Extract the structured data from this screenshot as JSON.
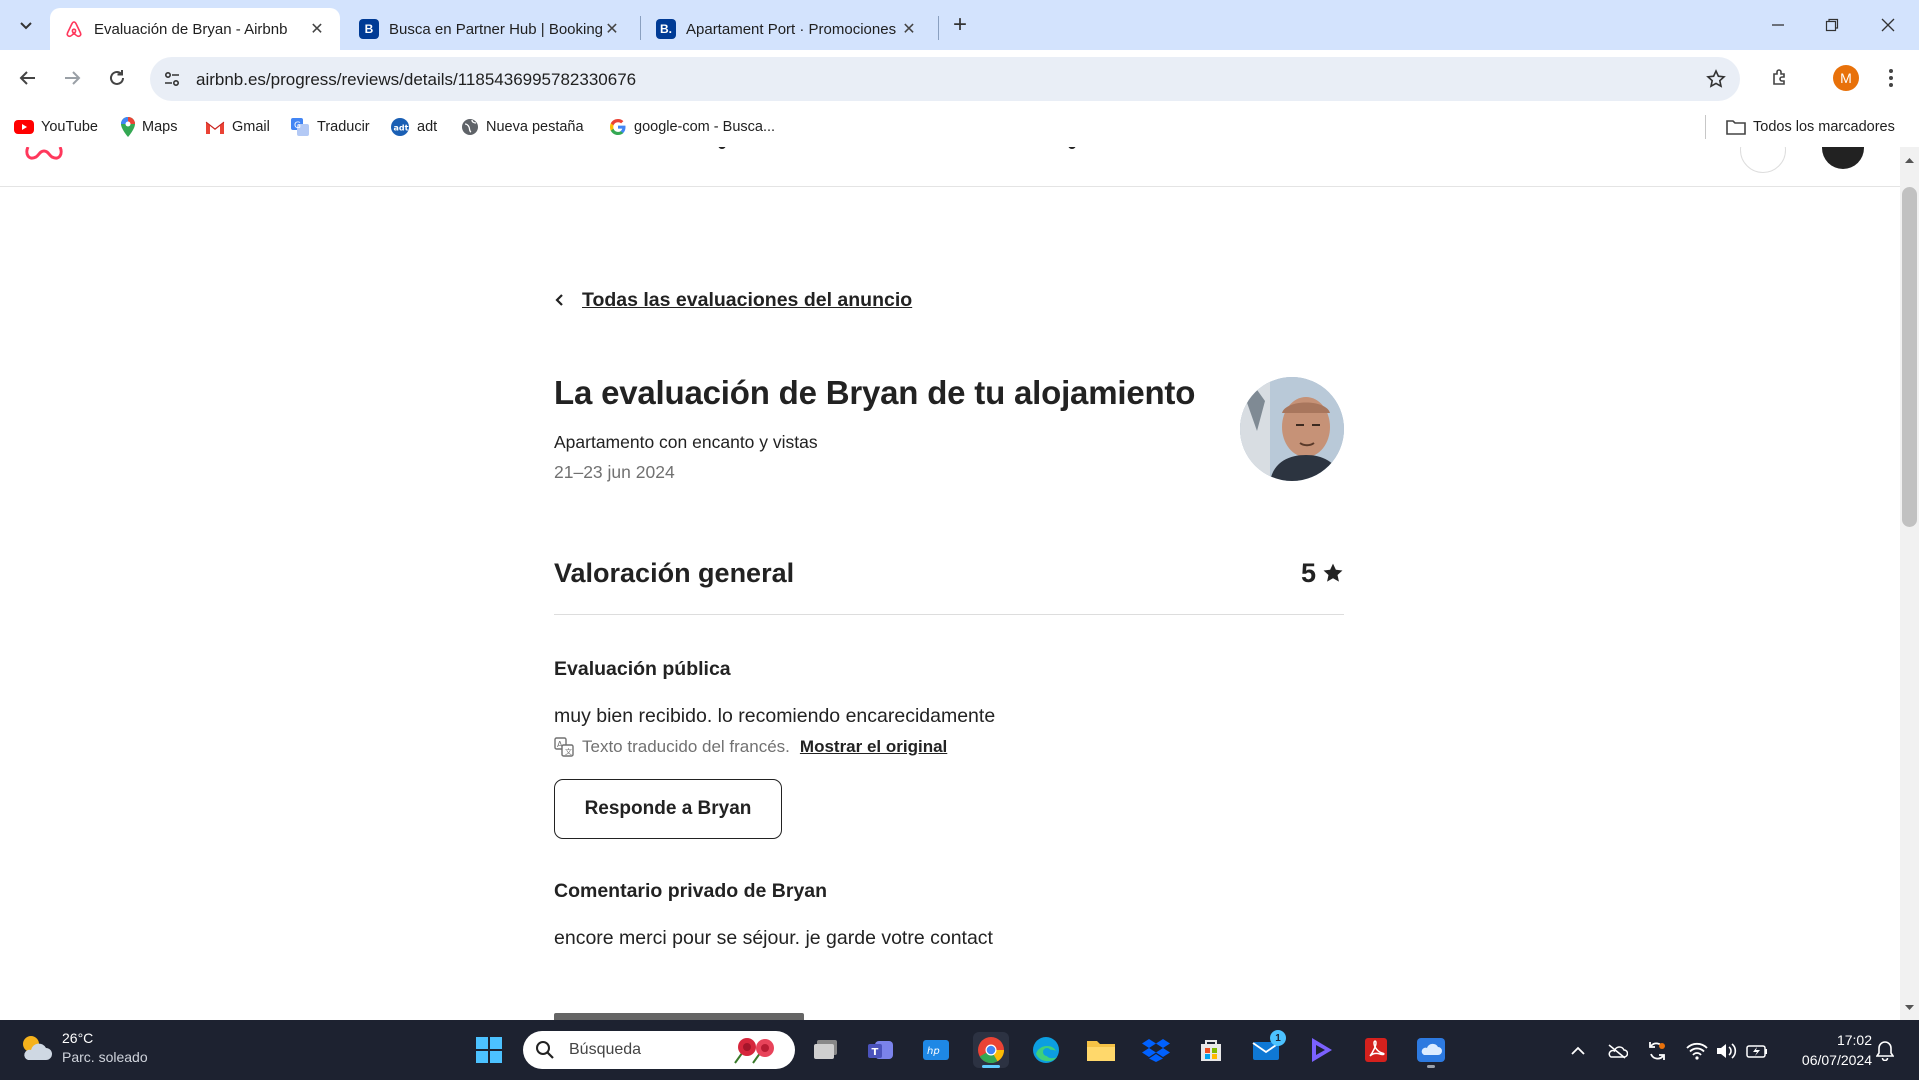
{
  "browser": {
    "tabs": [
      {
        "title": "Evaluación de Bryan - Airbnb",
        "active": true
      },
      {
        "title": "Busca en Partner Hub | Booking",
        "active": false
      },
      {
        "title": "Apartament Port · Promociones",
        "active": false
      }
    ],
    "url": "airbnb.es/progress/reviews/details/1185436995782330676",
    "profile_initial": "M",
    "bookmarks": [
      {
        "label": "YouTube",
        "icon": "youtube-icon"
      },
      {
        "label": "Maps",
        "icon": "maps-pin-icon"
      },
      {
        "label": "Gmail",
        "icon": "gmail-icon"
      },
      {
        "label": "Traducir",
        "icon": "translate-icon"
      },
      {
        "label": "adt",
        "icon": "adt-icon"
      },
      {
        "label": "Nueva pestaña",
        "icon": "globe-icon"
      },
      {
        "label": "google-com - Busca...",
        "icon": "google-icon"
      }
    ],
    "all_bookmarks_label": "Todos los marcadores"
  },
  "page": {
    "back_link": "Todas las evaluaciones del anuncio",
    "title": "La evaluación de Bryan de tu alojamiento",
    "listing": "Apartamento con encanto y vistas",
    "dates": "21–23 jun 2024",
    "overall_label": "Valoración general",
    "overall_value": "5",
    "public_heading": "Evaluación pública",
    "public_text": "muy bien recibido. lo recomiendo encarecidamente",
    "translated_note": "Texto traducido del francés.",
    "show_original": "Mostrar el original",
    "reply_button": "Responde a Bryan",
    "private_heading": "Comentario privado de Bryan",
    "private_text": "encore merci pour se séjour. je garde votre contact"
  },
  "taskbar": {
    "weather_temp": "26°C",
    "weather_desc": "Parc. soleado",
    "search_placeholder": "Búsqueda",
    "mail_badge": "1",
    "time": "17:02",
    "date": "06/07/2024"
  },
  "colors": {
    "airbnb": "#ff385c",
    "tabstrip": "#d3e3fd",
    "taskbar": "#1d2230"
  }
}
